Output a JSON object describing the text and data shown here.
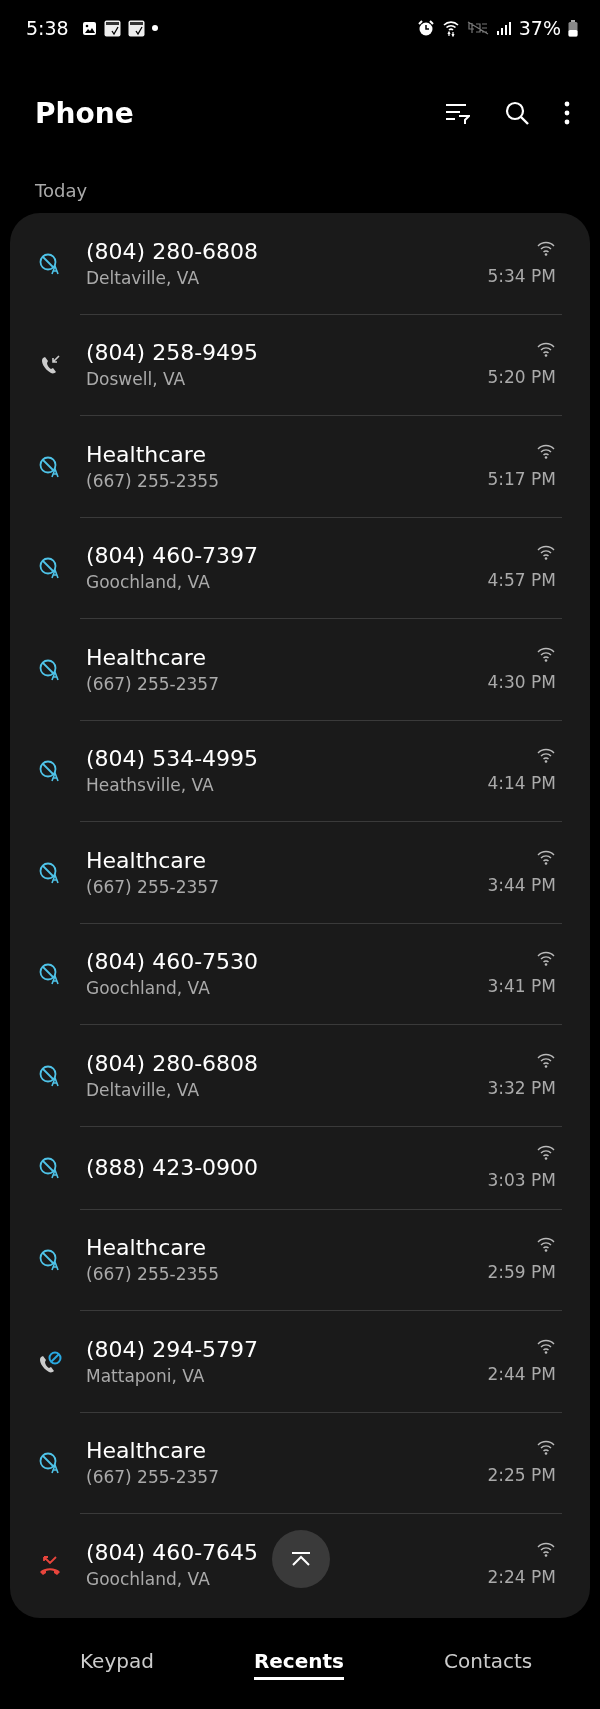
{
  "status_bar": {
    "time": "5:38",
    "battery": "37%"
  },
  "header": {
    "title": "Phone"
  },
  "section": "Today",
  "calls": [
    {
      "kind": "auto_rejected",
      "name": "(804) 280-6808",
      "detail": "Deltaville, VA",
      "time": "5:34 PM"
    },
    {
      "kind": "incoming",
      "name": "(804) 258-9495",
      "detail": "Doswell, VA",
      "time": "5:20 PM"
    },
    {
      "kind": "auto_rejected",
      "name": "Healthcare",
      "detail": "(667) 255-2355",
      "time": "5:17 PM"
    },
    {
      "kind": "auto_rejected",
      "name": "(804) 460-7397",
      "detail": "Goochland, VA",
      "time": "4:57 PM"
    },
    {
      "kind": "auto_rejected",
      "name": "Healthcare",
      "detail": "(667) 255-2357",
      "time": "4:30 PM"
    },
    {
      "kind": "auto_rejected",
      "name": "(804) 534-4995",
      "detail": "Heathsville, VA",
      "time": "4:14 PM"
    },
    {
      "kind": "auto_rejected",
      "name": "Healthcare",
      "detail": "(667) 255-2357",
      "time": "3:44 PM"
    },
    {
      "kind": "auto_rejected",
      "name": "(804) 460-7530",
      "detail": "Goochland, VA",
      "time": "3:41 PM"
    },
    {
      "kind": "auto_rejected",
      "name": "(804) 280-6808",
      "detail": "Deltaville, VA",
      "time": "3:32 PM"
    },
    {
      "kind": "auto_rejected",
      "name": "(888) 423-0900",
      "time": "3:03 PM"
    },
    {
      "kind": "auto_rejected",
      "name": "Healthcare",
      "detail": "(667) 255-2355",
      "time": "2:59 PM"
    },
    {
      "kind": "blocked",
      "name": "(804) 294-5797",
      "detail": "Mattaponi, VA",
      "time": "2:44 PM"
    },
    {
      "kind": "auto_rejected",
      "name": "Healthcare",
      "detail": "(667) 255-2357",
      "time": "2:25 PM"
    },
    {
      "kind": "missed",
      "name": "(804) 460-7645",
      "detail": "Goochland, VA",
      "time": "2:24 PM"
    }
  ],
  "tabs": [
    {
      "label": "Keypad",
      "selected": false
    },
    {
      "label": "Recents",
      "selected": true
    },
    {
      "label": "Contacts",
      "selected": false
    }
  ]
}
